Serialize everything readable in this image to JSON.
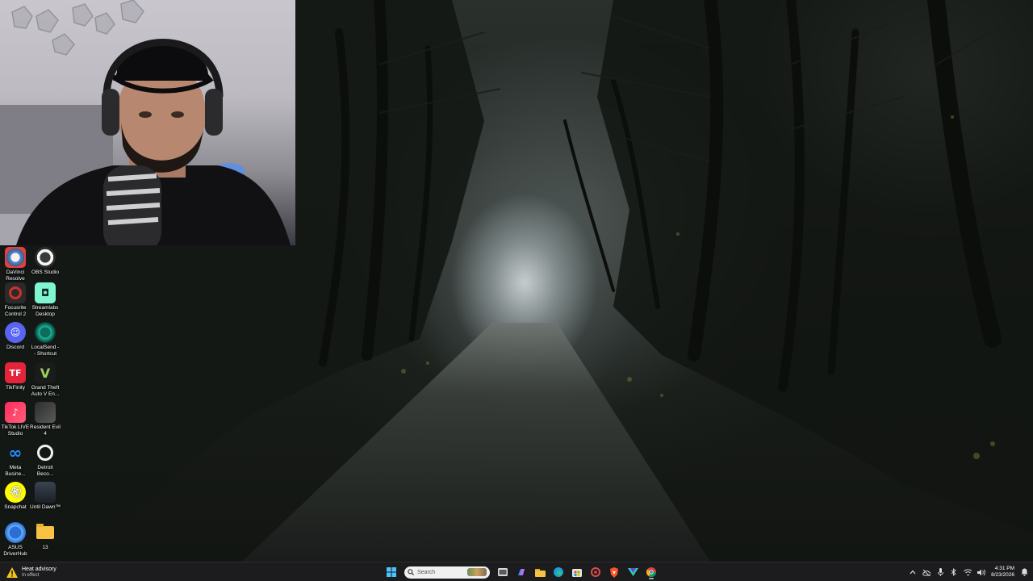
{
  "desktop": {
    "icons": [
      {
        "label": "DaVinci\nResolve",
        "icon": "davinci-resolve-icon"
      },
      {
        "label": "OBS Studio",
        "icon": "obs-studio-icon"
      },
      {
        "label": "Focusrite\nControl 2",
        "icon": "focusrite-icon"
      },
      {
        "label": "Streamlabs\nDesktop",
        "icon": "streamlabs-icon"
      },
      {
        "label": "Discord",
        "icon": "discord-icon"
      },
      {
        "label": "LocalSend -\n- Shortcut",
        "icon": "localsend-icon"
      },
      {
        "label": "TikFinity",
        "icon": "tikfinity-icon"
      },
      {
        "label": "Grand Theft\nAuto V En...",
        "icon": "gta-v-icon"
      },
      {
        "label": "TikTok LIVE\nStudio",
        "icon": "tiktok-live-icon"
      },
      {
        "label": "Resident Evil\n4",
        "icon": "resident-evil-icon"
      },
      {
        "label": "Meta\nBusine...",
        "icon": "meta-business-icon"
      },
      {
        "label": "Detroit\nBeco...",
        "icon": "detroit-icon"
      },
      {
        "label": "Snapchat",
        "icon": "snapchat-icon"
      },
      {
        "label": "Until Dawn™",
        "icon": "until-dawn-icon"
      },
      {
        "label": "ASUS\nDriverHub",
        "icon": "asus-driverhub-icon"
      },
      {
        "label": "13",
        "icon": "folder-icon"
      }
    ]
  },
  "taskbar": {
    "weather": {
      "title": "Heat advisory",
      "subtitle": "In effect",
      "icon": "warning-icon"
    },
    "search_placeholder": "Search",
    "apps": [
      "file-manager-icon",
      "copilot-icon",
      "edge-icon",
      "store-icon",
      "unknown-red-icon",
      "brave-icon",
      "vpn-icon",
      "chrome-icon"
    ],
    "clock": {
      "time": "4:31 PM",
      "date": "8/23/2026"
    }
  },
  "colors": {
    "taskbar_bg": "#1c1c1f",
    "accent": "#1f8fff"
  }
}
